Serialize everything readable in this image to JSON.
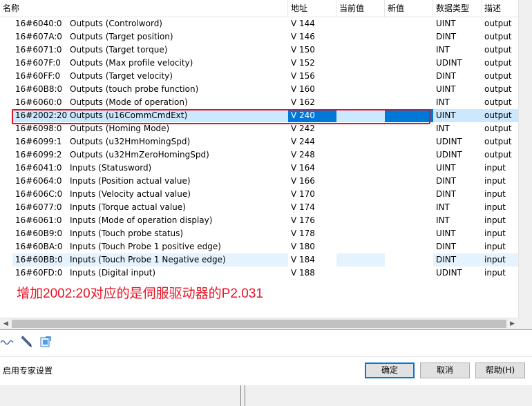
{
  "columns": {
    "name": "名称",
    "address": "地址",
    "current_value": "当前值",
    "new_value": "新值",
    "data_type": "数据类型",
    "description": "描述"
  },
  "rows": [
    {
      "index": "16#6040:0",
      "name": "Outputs (Controlword)",
      "address": "V 144",
      "type": "UINT",
      "desc": "output"
    },
    {
      "index": "16#607A:0",
      "name": "Outputs (Target position)",
      "address": "V 146",
      "type": "DINT",
      "desc": "output"
    },
    {
      "index": "16#6071:0",
      "name": "Outputs (Target torque)",
      "address": "V 150",
      "type": "INT",
      "desc": "output"
    },
    {
      "index": "16#607F:0",
      "name": "Outputs (Max profile velocity)",
      "address": "V 152",
      "type": "UDINT",
      "desc": "output"
    },
    {
      "index": "16#60FF:0",
      "name": "Outputs (Target velocity)",
      "address": "V 156",
      "type": "DINT",
      "desc": "output"
    },
    {
      "index": "16#60B8:0",
      "name": "Outputs (touch probe function)",
      "address": "V 160",
      "type": "UINT",
      "desc": "output"
    },
    {
      "index": "16#6060:0",
      "name": "Outputs (Mode of operation)",
      "address": "V 162",
      "type": "INT",
      "desc": "output"
    },
    {
      "index": "16#2002:20",
      "name": "Outputs (u16CommCmdExt)",
      "address": "V 240",
      "type": "UINT",
      "desc": "output"
    },
    {
      "index": "16#6098:0",
      "name": "Outputs (Homing Mode)",
      "address": "V 242",
      "type": "INT",
      "desc": "output"
    },
    {
      "index": "16#6099:1",
      "name": "Outputs (u32HmHomingSpd)",
      "address": "V 244",
      "type": "UDINT",
      "desc": "output"
    },
    {
      "index": "16#6099:2",
      "name": "Outputs (u32HmZeroHomingSpd)",
      "address": "V 248",
      "type": "UDINT",
      "desc": "output"
    },
    {
      "index": "16#6041:0",
      "name": "Inputs (Statusword)",
      "address": "V 164",
      "type": "UINT",
      "desc": "input"
    },
    {
      "index": "16#6064:0",
      "name": "Inputs (Position actual value)",
      "address": "V 166",
      "type": "DINT",
      "desc": "input"
    },
    {
      "index": "16#606C:0",
      "name": "Inputs (Velocity actual value)",
      "address": "V 170",
      "type": "DINT",
      "desc": "input"
    },
    {
      "index": "16#6077:0",
      "name": "Inputs (Torque actual value)",
      "address": "V 174",
      "type": "INT",
      "desc": "input"
    },
    {
      "index": "16#6061:0",
      "name": "Inputs (Mode of operation display)",
      "address": "V 176",
      "type": "INT",
      "desc": "input"
    },
    {
      "index": "16#60B9:0",
      "name": "Inputs (Touch probe status)",
      "address": "V 178",
      "type": "UINT",
      "desc": "input"
    },
    {
      "index": "16#60BA:0",
      "name": "Inputs (Touch Probe 1 positive edge)",
      "address": "V 180",
      "type": "DINT",
      "desc": "input"
    },
    {
      "index": "16#60BB:0",
      "name": "Inputs (Touch Probe 1 Negative edge)",
      "address": "V 184",
      "type": "DINT",
      "desc": "input"
    },
    {
      "index": "16#60FD:0",
      "name": "Inputs (Digital input)",
      "address": "V 188",
      "type": "UDINT",
      "desc": "input"
    }
  ],
  "selected_row": 7,
  "hovered_row": 18,
  "annotation": "增加2002:20对应的是伺服驱动器的P2.031",
  "annotation_color": "#e81123",
  "selection_color": "#0078d7",
  "toolbar_icons": [
    "wave-icon",
    "pencil-icon",
    "export-icon"
  ],
  "footer": {
    "expert_label": "启用专家设置",
    "ok_label": "确定",
    "cancel_label": "取消",
    "help_label": "帮助(H)"
  }
}
